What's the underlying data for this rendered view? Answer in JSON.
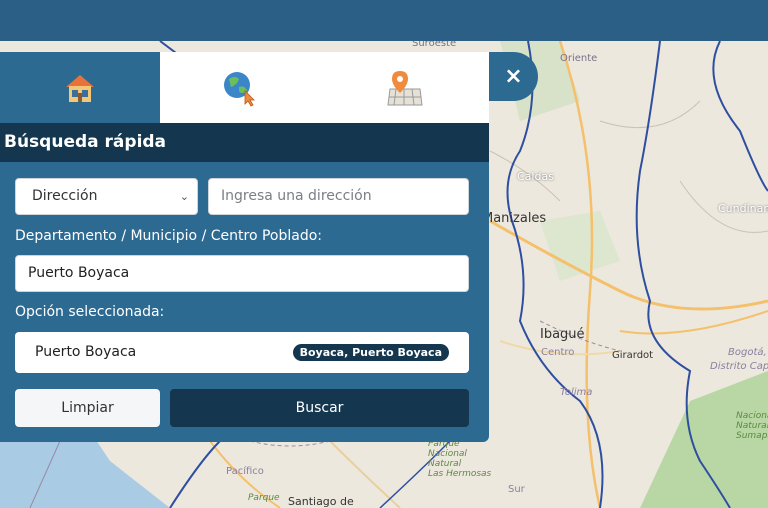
{
  "map": {
    "labels": {
      "suroeste": "Suroeste",
      "oriente": "Oriente",
      "caldas": "Caldas",
      "manizales": "Manizales",
      "cundinamarca": "Cundinamarca",
      "ibague": "Ibagué",
      "centro": "Centro",
      "girardot": "Girardot",
      "bogota": "Bogotá,",
      "distrito": "Distrito Capital",
      "tolima": "Tolima",
      "parque_nacional": "Parque\nNacional\nNatural\nLas Hermosas",
      "sur": "Sur",
      "pacifico": "Pacífico",
      "parque": "Parque",
      "santiago": "Santiago de",
      "nacional": "Nacional\nNatural\nSumapaz"
    },
    "colors": {
      "water": "#a9cbe3",
      "boundary": "#2e4fa0",
      "road": "#f4c06b",
      "green": "#b9d7a5"
    }
  },
  "tabs": [
    {
      "icon": "house-icon",
      "active": true
    },
    {
      "icon": "globe-cursor-icon",
      "active": false
    },
    {
      "icon": "map-pin-grid-icon",
      "active": false
    }
  ],
  "panel": {
    "title": "Búsqueda rápida",
    "select": {
      "value": "Dirección"
    },
    "address": {
      "placeholder": "Ingresa una dirección"
    },
    "place_label": "Departamento / Municipio / Centro Poblado:",
    "place_value": "Puerto Boyaca",
    "selected_label": "Opción seleccionada:",
    "selected_value": "Puerto Boyaca",
    "selected_badge": "Boyaca, Puerto Boyaca",
    "clear_button": "Limpiar",
    "search_button": "Buscar",
    "close": "×"
  },
  "colors": {
    "header": "#2b5f86",
    "panel": "#2d6a92",
    "dark": "#14374f"
  }
}
